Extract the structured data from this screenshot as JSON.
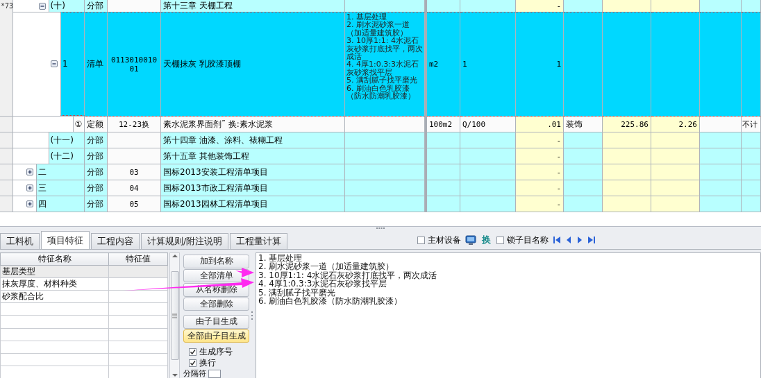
{
  "grid": {
    "rows": [
      {
        "kind": "continuation",
        "children": [
          {
            "kind": "section",
            "gutter_note": "*73",
            "expanded": true,
            "selected": false,
            "number": "(十)",
            "column_2": "分部",
            "column_4": "第十三章  天棚工程",
            "column_8": "-",
            "children": [
              {
                "kind": "bill",
                "expanded": true,
                "selected": true,
                "number": "1",
                "column_2": "清单",
                "column_3": "011301001001",
                "column_4": "天棚抹灰 乳胶漆顶棚",
                "column_5": [
                  "1. 基层处理",
                  "2. 刷水泥砂浆一道（加适量建筑胶）",
                  "3. 10厚1:1: 4水泥石灰砂浆打底找平，两次成活",
                  "4. 4厚1:0.3:3水泥石灰砂浆找平层",
                  "5. 满刮腻子找平磨光",
                  "6. 刷油白色乳胶漆（防水防潮乳胶漆）"
                ],
                "column_6": "m2",
                "column_7": "1",
                "column_8": "1",
                "children": [
                  {
                    "kind": "quota",
                    "selected": false,
                    "number": "①",
                    "column_2": "定额",
                    "column_3": "12-23换",
                    "column_4": "素水泥浆界面剂˜ 换:素水泥浆",
                    "column_6": "100m2",
                    "column_7": "Q/100",
                    "column_8": ".01",
                    "column_9": "装饰",
                    "column_10": "225.86",
                    "column_11": "2.26",
                    "column_13": "不计"
                  }
                ]
              }
            ]
          },
          {
            "kind": "section",
            "selected": false,
            "number": "(十一)",
            "column_2": "分部",
            "column_4": "第十四章  油漆、涂料、裱糊工程",
            "column_8": "-"
          },
          {
            "kind": "section",
            "selected": false,
            "number": "(十二)",
            "column_2": "分部",
            "column_4": "第十五章  其他装饰工程",
            "column_8": "-"
          }
        ]
      },
      {
        "kind": "section",
        "expanded": false,
        "selected": false,
        "number": "二",
        "column_2": "分部",
        "column_3": "03",
        "column_4": "国标2013安装工程清单项目",
        "column_8": "-"
      },
      {
        "kind": "section",
        "expanded": false,
        "selected": false,
        "number": "三",
        "column_2": "分部",
        "column_3": "04",
        "column_4": "国标2013市政工程清单项目",
        "column_8": "-"
      },
      {
        "kind": "section",
        "expanded": false,
        "selected": false,
        "number": "四",
        "column_2": "分部",
        "column_3": "05",
        "column_4": "国标2013园林工程清单项目",
        "column_8": "-"
      }
    ]
  },
  "bottom_panel": {
    "tabs": [
      {
        "label": "工料机",
        "selected": false
      },
      {
        "label": "项目特征",
        "selected": true
      },
      {
        "label": "工程内容",
        "selected": false
      },
      {
        "label": "计算规则/附注说明",
        "selected": false
      },
      {
        "label": "工程量计算",
        "selected": false
      }
    ],
    "toolbar": [
      {
        "kind": "checkbox",
        "label": "主材设备",
        "checked": false
      },
      {
        "kind": "monitor"
      },
      {
        "kind": "text-button",
        "label": "换"
      },
      {
        "kind": "checkbox",
        "label": "锁子目名称",
        "checked": false
      },
      {
        "kind": "nav-first"
      },
      {
        "kind": "nav-prev"
      },
      {
        "kind": "nav-next"
      },
      {
        "kind": "nav-last"
      }
    ],
    "feature_table": {
      "columns": [
        "特征名称",
        "特征值"
      ],
      "rows": [
        {
          "name": "基层类型",
          "selected": true
        },
        {
          "name": "抹灰厚度、材料种类",
          "selected": false
        },
        {
          "name": "砂浆配合比",
          "selected": false
        }
      ]
    },
    "action_groups": [
      [
        {
          "label": "加到名称",
          "highlighted": false
        },
        {
          "label": "全部清单",
          "highlighted": false
        },
        {
          "label": "从名称删除",
          "highlighted": false
        },
        {
          "label": "全部删除",
          "highlighted": false
        }
      ],
      [
        {
          "label": "由子目生成",
          "highlighted": false
        },
        {
          "label": "全部由子目生成",
          "highlighted": true
        }
      ]
    ],
    "options": [
      {
        "label": "生成序号",
        "checked": true
      },
      {
        "label": "换行",
        "checked": true
      }
    ],
    "separator": {
      "label": "分隔符"
    },
    "description": [
      "1. 基层处理",
      "2. 刷水泥砂浆一道（加适量建筑胶）",
      "3. 10厚1:1: 4水泥石灰砂浆打底找平，两次成活",
      "4. 4厚1:0.3:3水泥石灰砂浆找平层",
      "5. 满刮腻子找平磨光",
      "6. 刷油白色乳胶漆（防水防潮乳胶漆）"
    ]
  }
}
